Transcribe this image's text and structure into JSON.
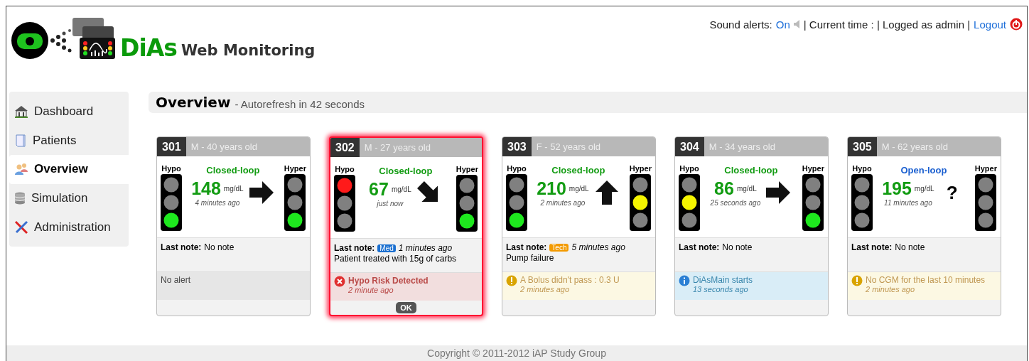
{
  "header": {
    "logo_main": "DiAs",
    "logo_sub": "Web Monitoring",
    "sound_label": "Sound alerts:",
    "sound_state": "On",
    "status_text": "| Current time : | Logged as admin |",
    "logout": "Logout"
  },
  "sidebar": {
    "items": [
      {
        "label": "Dashboard",
        "selected": false
      },
      {
        "label": "Patients",
        "selected": false
      },
      {
        "label": "Overview",
        "selected": true
      },
      {
        "label": "Simulation",
        "selected": false
      },
      {
        "label": "Administration",
        "selected": false
      }
    ]
  },
  "overview": {
    "title": "Overview",
    "subtitle": "- Autorefresh in 42 seconds"
  },
  "cards": [
    {
      "id": "301",
      "patient": "M - 40 years old",
      "alarm": false,
      "hypo_label": "Hypo",
      "hyper_label": "Hyper",
      "mode": {
        "kind": "closed",
        "label": "Closed-loop"
      },
      "glucose": "148",
      "unit": "mg/dL",
      "ago": "4 minutes ago",
      "hypo": {
        "red": false,
        "yellow": false,
        "green": true
      },
      "hyper": {
        "red": false,
        "yellow": false,
        "green": true
      },
      "trend": {
        "kind": "right"
      },
      "note": {
        "label": "Last note:",
        "text": "No note"
      },
      "alert": {
        "kind": "none",
        "title": "No alert"
      }
    },
    {
      "id": "302",
      "patient": "M - 27 years old",
      "alarm": true,
      "hypo_label": "Hypo",
      "hyper_label": "Hyper",
      "mode": {
        "kind": "closed",
        "label": "Closed-loop"
      },
      "glucose": "67",
      "unit": "mg/dL",
      "ago": "just now",
      "hypo": {
        "red": true,
        "yellow": false,
        "green": false
      },
      "hyper": {
        "red": false,
        "yellow": false,
        "green": true
      },
      "trend": {
        "kind": "down-right"
      },
      "note": {
        "label": "Last note:",
        "tag": {
          "text": "Med",
          "kind": "med"
        },
        "ago": "1 minutes ago",
        "text": "Patient treated with 15g of carbs"
      },
      "alert": {
        "kind": "error",
        "title": "Hypo Risk Detected",
        "ago": "2 minute ago"
      },
      "ok_button": "OK"
    },
    {
      "id": "303",
      "patient": "F - 52 years old",
      "alarm": false,
      "hypo_label": "Hypo",
      "hyper_label": "Hyper",
      "mode": {
        "kind": "closed",
        "label": "Closed-loop"
      },
      "glucose": "210",
      "unit": "mg/dL",
      "ago": "2 minutes ago",
      "hypo": {
        "red": false,
        "yellow": false,
        "green": true
      },
      "hyper": {
        "red": false,
        "yellow": true,
        "green": false
      },
      "trend": {
        "kind": "up"
      },
      "note": {
        "label": "Last note:",
        "tag": {
          "text": "Tech",
          "kind": "tech"
        },
        "ago": "5 minutes ago",
        "text": "Pump failure"
      },
      "alert": {
        "kind": "warning",
        "title": "A Bolus didn't pass : 0.3 U",
        "ago": "2 minutes ago"
      }
    },
    {
      "id": "304",
      "patient": "M - 34 years old",
      "alarm": false,
      "hypo_label": "Hypo",
      "hyper_label": "Hyper",
      "mode": {
        "kind": "closed",
        "label": "Closed-loop"
      },
      "glucose": "86",
      "unit": "mg/dL",
      "ago": "25 seconds ago",
      "hypo": {
        "red": false,
        "yellow": true,
        "green": false
      },
      "hyper": {
        "red": false,
        "yellow": false,
        "green": true
      },
      "trend": {
        "kind": "right"
      },
      "note": {
        "label": "Last note:",
        "text": "No note"
      },
      "alert": {
        "kind": "info",
        "title": "DiAsMain starts",
        "ago": "13 seconds ago"
      }
    },
    {
      "id": "305",
      "patient": "M - 62 years old",
      "alarm": false,
      "hypo_label": "Hypo",
      "hyper_label": "Hyper",
      "mode": {
        "kind": "open",
        "label": "Open-loop"
      },
      "glucose": "195",
      "unit": "mg/dL",
      "ago": "11 minutes ago",
      "hypo": {
        "red": false,
        "yellow": false,
        "green": false
      },
      "hyper": {
        "red": false,
        "yellow": false,
        "green": false
      },
      "trend": {
        "kind": "text",
        "text": "?"
      },
      "note": {
        "label": "Last note:",
        "text": "No note"
      },
      "alert": {
        "kind": "warning",
        "title": "No CGM for the last 10 minutes",
        "ago": "2 minutes ago"
      }
    }
  ],
  "footer": {
    "copyright": "Copyright © 2011-2012 iAP Study Group"
  }
}
